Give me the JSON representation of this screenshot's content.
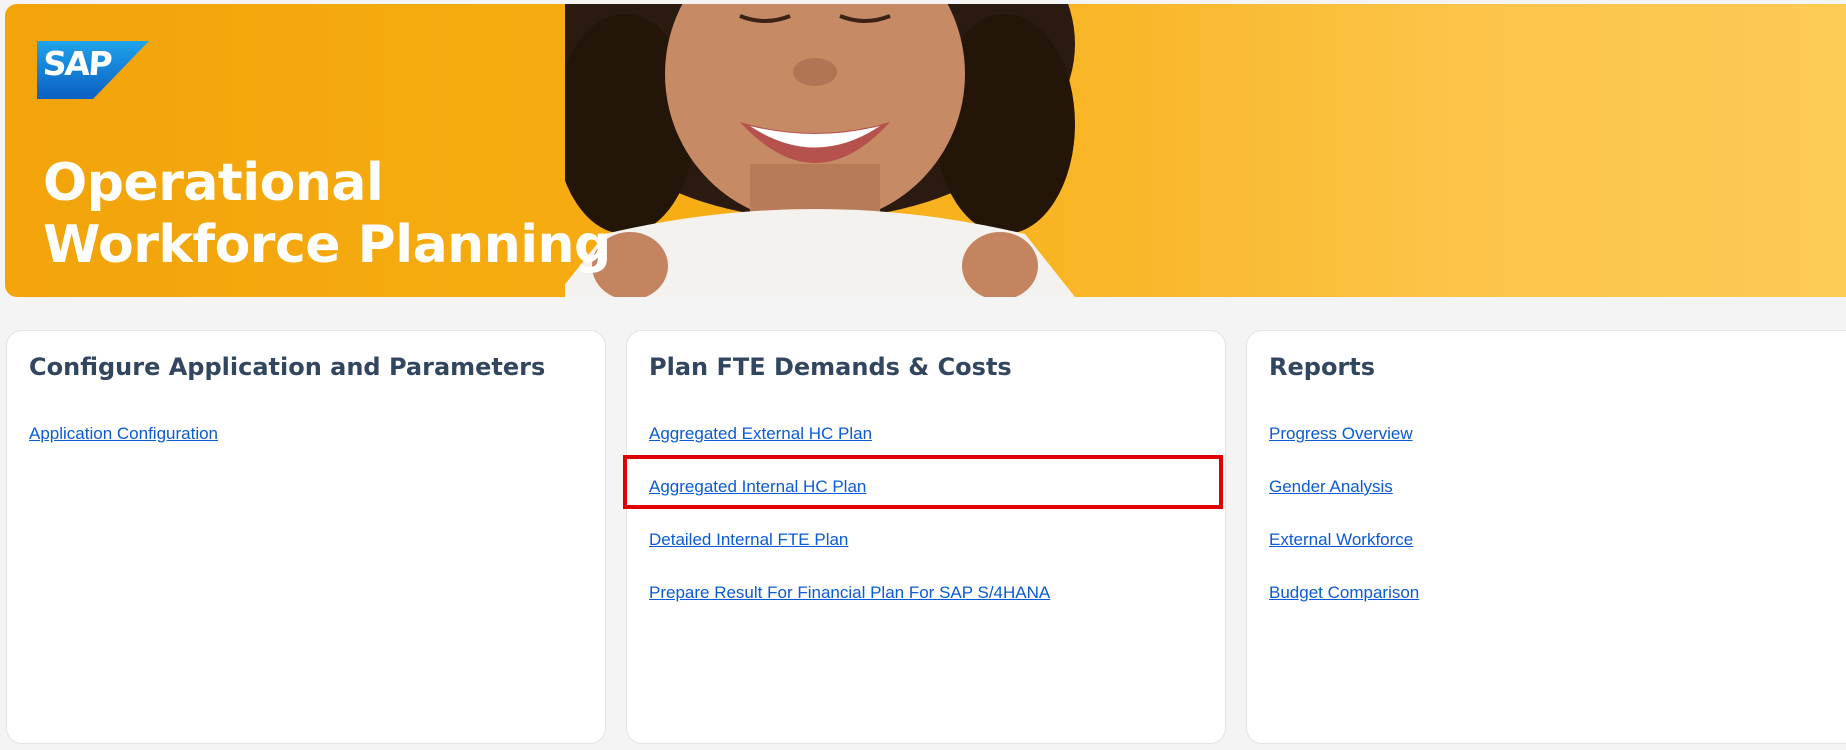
{
  "banner": {
    "logo_text": "SAP",
    "title_line1": "Operational",
    "title_line2": "Workforce Planning"
  },
  "cards": [
    {
      "title": "Configure Application and Parameters",
      "links": [
        "Application Configuration"
      ]
    },
    {
      "title": "Plan FTE Demands & Costs",
      "links": [
        "Aggregated External HC Plan",
        "Aggregated Internal HC Plan",
        "Detailed Internal FTE Plan",
        "Prepare Result For Financial Plan For SAP S/4HANA"
      ]
    },
    {
      "title": "Reports",
      "links": [
        "Progress Overview",
        "Gender Analysis",
        "External Workforce",
        "Budget Comparison"
      ]
    }
  ],
  "colors": {
    "banner_orange": "#f2a40a",
    "card_title": "#32475f",
    "link": "#0a5bd4",
    "highlight": "#e00000",
    "sap_blue": "#1a73d0"
  },
  "icons": [
    "sap-logo",
    "banner-photo"
  ]
}
